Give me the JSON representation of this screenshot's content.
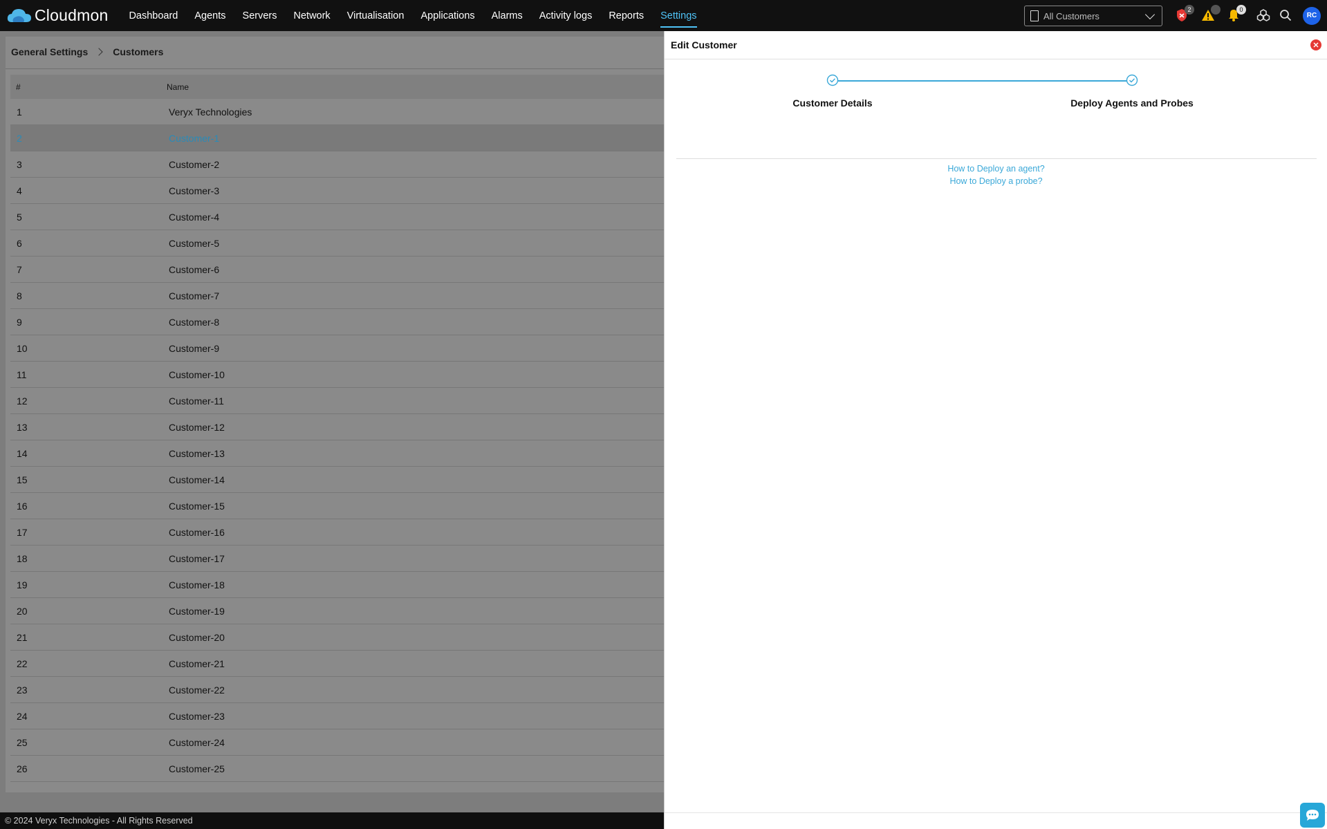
{
  "brand": {
    "name": "Cloudmon"
  },
  "nav": {
    "items": [
      {
        "label": "Dashboard"
      },
      {
        "label": "Agents"
      },
      {
        "label": "Servers"
      },
      {
        "label": "Network"
      },
      {
        "label": "Virtualisation"
      },
      {
        "label": "Applications"
      },
      {
        "label": "Alarms"
      },
      {
        "label": "Activity logs"
      },
      {
        "label": "Reports"
      },
      {
        "label": "Settings",
        "active": true
      }
    ]
  },
  "topbar": {
    "customer_select": {
      "value": "All Customers"
    },
    "security_badge": "2",
    "warning_badge": "",
    "bell_badge": "0",
    "avatar_initials": "RC",
    "accent_color": "#4fc3f7"
  },
  "breadcrumb": {
    "parent": "General Settings",
    "current": "Customers"
  },
  "table": {
    "headers": {
      "num": "#",
      "name": "Name"
    },
    "rows": [
      {
        "num": "1",
        "name": "Veryx Technologies"
      },
      {
        "num": "2",
        "name": "Customer-1",
        "selected": true
      },
      {
        "num": "3",
        "name": "Customer-2"
      },
      {
        "num": "4",
        "name": "Customer-3"
      },
      {
        "num": "5",
        "name": "Customer-4"
      },
      {
        "num": "6",
        "name": "Customer-5"
      },
      {
        "num": "7",
        "name": "Customer-6"
      },
      {
        "num": "8",
        "name": "Customer-7"
      },
      {
        "num": "9",
        "name": "Customer-8"
      },
      {
        "num": "10",
        "name": "Customer-9"
      },
      {
        "num": "11",
        "name": "Customer-10"
      },
      {
        "num": "12",
        "name": "Customer-11"
      },
      {
        "num": "13",
        "name": "Customer-12"
      },
      {
        "num": "14",
        "name": "Customer-13"
      },
      {
        "num": "15",
        "name": "Customer-14"
      },
      {
        "num": "16",
        "name": "Customer-15"
      },
      {
        "num": "17",
        "name": "Customer-16"
      },
      {
        "num": "18",
        "name": "Customer-17"
      },
      {
        "num": "19",
        "name": "Customer-18"
      },
      {
        "num": "20",
        "name": "Customer-19"
      },
      {
        "num": "21",
        "name": "Customer-20"
      },
      {
        "num": "22",
        "name": "Customer-21"
      },
      {
        "num": "23",
        "name": "Customer-22"
      },
      {
        "num": "24",
        "name": "Customer-23"
      },
      {
        "num": "25",
        "name": "Customer-24"
      },
      {
        "num": "26",
        "name": "Customer-25"
      }
    ]
  },
  "footer": {
    "text": "© 2024 Veryx Technologies - All Rights Reserved"
  },
  "drawer": {
    "title": "Edit Customer",
    "steps": [
      {
        "label": "Customer Details",
        "completed": true
      },
      {
        "label": "Deploy Agents and Probes",
        "completed": true
      }
    ],
    "links": {
      "agent": "How to Deploy an agent?",
      "probe": "How to Deploy a probe?"
    },
    "step_color": "#3aa8d8"
  }
}
